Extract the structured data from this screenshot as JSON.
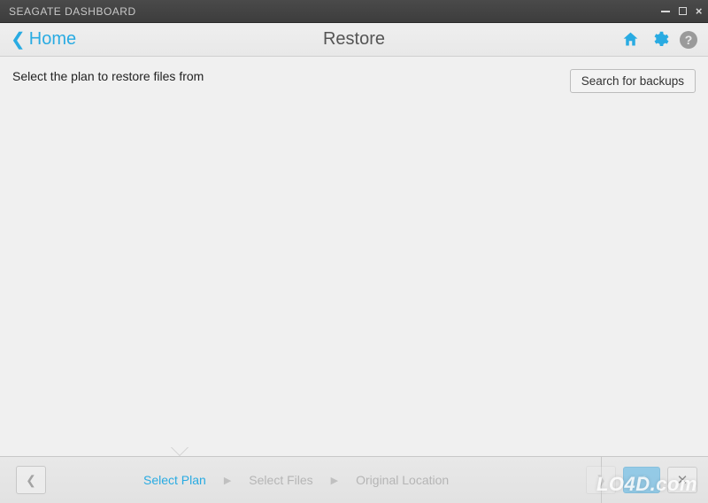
{
  "titlebar": {
    "title": "SEAGATE DASHBOARD"
  },
  "header": {
    "back_label": "Home",
    "title": "Restore"
  },
  "content": {
    "instruction": "Select the plan to restore files from",
    "search_button": "Search for backups"
  },
  "footer": {
    "steps": [
      "Select Plan",
      "Select Files",
      "Original Location"
    ],
    "active_step_index": 0
  },
  "watermark": "LO4D.com",
  "colors": {
    "accent": "#29abe2",
    "bg": "#f0f0f0"
  }
}
